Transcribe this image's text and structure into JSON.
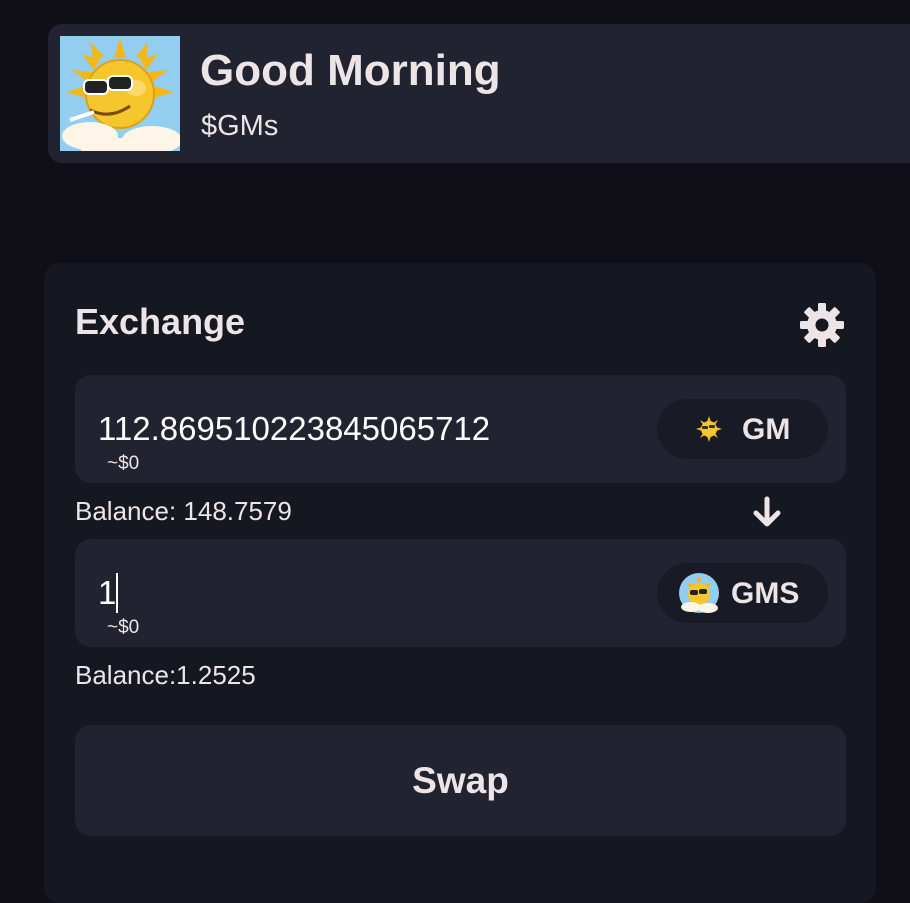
{
  "token": {
    "name": "Good Morning",
    "symbol": "$GMs",
    "logo_icon": "sun-with-sunglasses-logo"
  },
  "exchange": {
    "title": "Exchange",
    "settings_icon": "gear-icon",
    "from": {
      "amount": "112.869510223845065712",
      "usd_value": "~$0",
      "token_label": "GM",
      "token_icon": "sun-token-icon",
      "balance": "Balance: 148.7579"
    },
    "direction_icon": "arrow-down-icon",
    "to": {
      "amount": "1",
      "usd_value": "~$0",
      "token_label": "GMS",
      "token_icon": "sun-face-token-icon",
      "balance": "Balance:1.2525"
    },
    "swap_label": "Swap"
  },
  "colors": {
    "background": "#100f17",
    "card": "#161821",
    "field": "#222330",
    "pill": "#181b26",
    "text": "#ece4e6",
    "sun": "#f6c62d",
    "sky": "#93cdef"
  }
}
